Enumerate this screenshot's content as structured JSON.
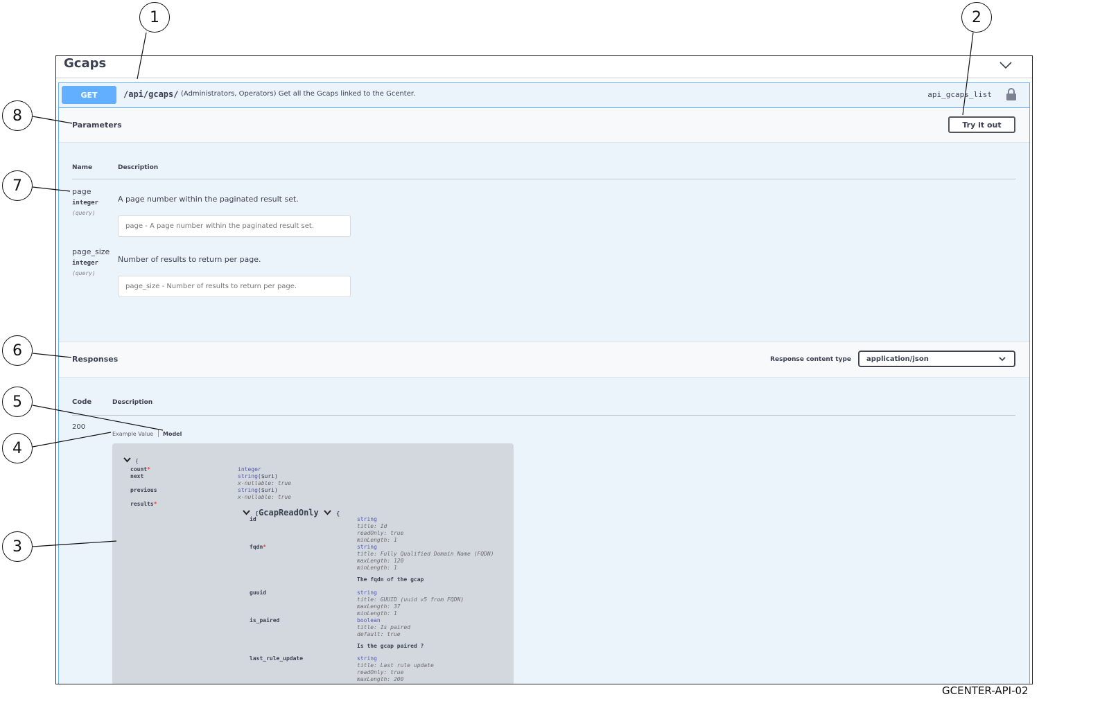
{
  "callouts": [
    "1",
    "2",
    "3",
    "4",
    "5",
    "6",
    "7",
    "8"
  ],
  "tag": {
    "title": "Gcaps"
  },
  "operation": {
    "method": "GET",
    "path": "/api/gcaps/",
    "description": "(Administrators, Operators) Get all the Gcaps linked to the Gcenter.",
    "operation_id": "api_gcaps_list"
  },
  "parameters": {
    "title": "Parameters",
    "try_label": "Try it out",
    "col_name": "Name",
    "col_description": "Description",
    "items": [
      {
        "name": "page",
        "type": "integer",
        "in": "(query)",
        "description": "A page number within the paginated result set.",
        "placeholder": "page - A page number within the paginated result set."
      },
      {
        "name": "page_size",
        "type": "integer",
        "in": "(query)",
        "description": "Number of results to return per page.",
        "placeholder": "page_size - Number of results to return per page."
      }
    ]
  },
  "responses": {
    "title": "Responses",
    "content_type_label": "Response content type",
    "content_type": "application/json",
    "col_code": "Code",
    "col_description": "Description",
    "code": "200",
    "tab_example": "Example Value",
    "tab_model": "Model"
  },
  "model": {
    "open_brace": "{",
    "count": "count",
    "count_type": "integer",
    "next": "next",
    "next_type": "string",
    "next_fmt": "($uri)",
    "next_null": "x-nullable: true",
    "previous": "previous",
    "previous_type": "string",
    "previous_fmt": "($uri)",
    "previous_null": "x-nullable: true",
    "results": "results",
    "results_model": "GcapReadOnly",
    "id": "id",
    "id_type": "string",
    "id_title": "title: Id",
    "id_ro": "readOnly: true",
    "id_min": "minLength: 1",
    "fqdn": "fqdn",
    "fqdn_type": "string",
    "fqdn_title": "title: Fully Qualified Domain Name (FQDN)",
    "fqdn_max": "maxLength: 120",
    "fqdn_min": "minLength: 1",
    "fqdn_desc": "The fqdn of the gcap",
    "guuid": "guuid",
    "guuid_type": "string",
    "guuid_title": "title: GUUID (uuid v5 from FQDN)",
    "guuid_max": "maxLength: 37",
    "guuid_min": "minLength: 1",
    "is_paired": "is_paired",
    "is_paired_type": "boolean",
    "is_paired_title": "title: Is paired",
    "is_paired_default": "default: true",
    "is_paired_desc": "Is the gcap paired ?",
    "last_rule_update": "last_rule_update",
    "lru_type": "string",
    "lru_title": "title: Last rule update",
    "lru_ro": "readOnly: true",
    "lru_max": "maxLength: 200"
  },
  "footer_id": "GCENTER-API-02",
  "colors": {
    "get": "#61affe",
    "opblock_bg": "#ebf3fb",
    "model_bg": "#d3d8df"
  }
}
